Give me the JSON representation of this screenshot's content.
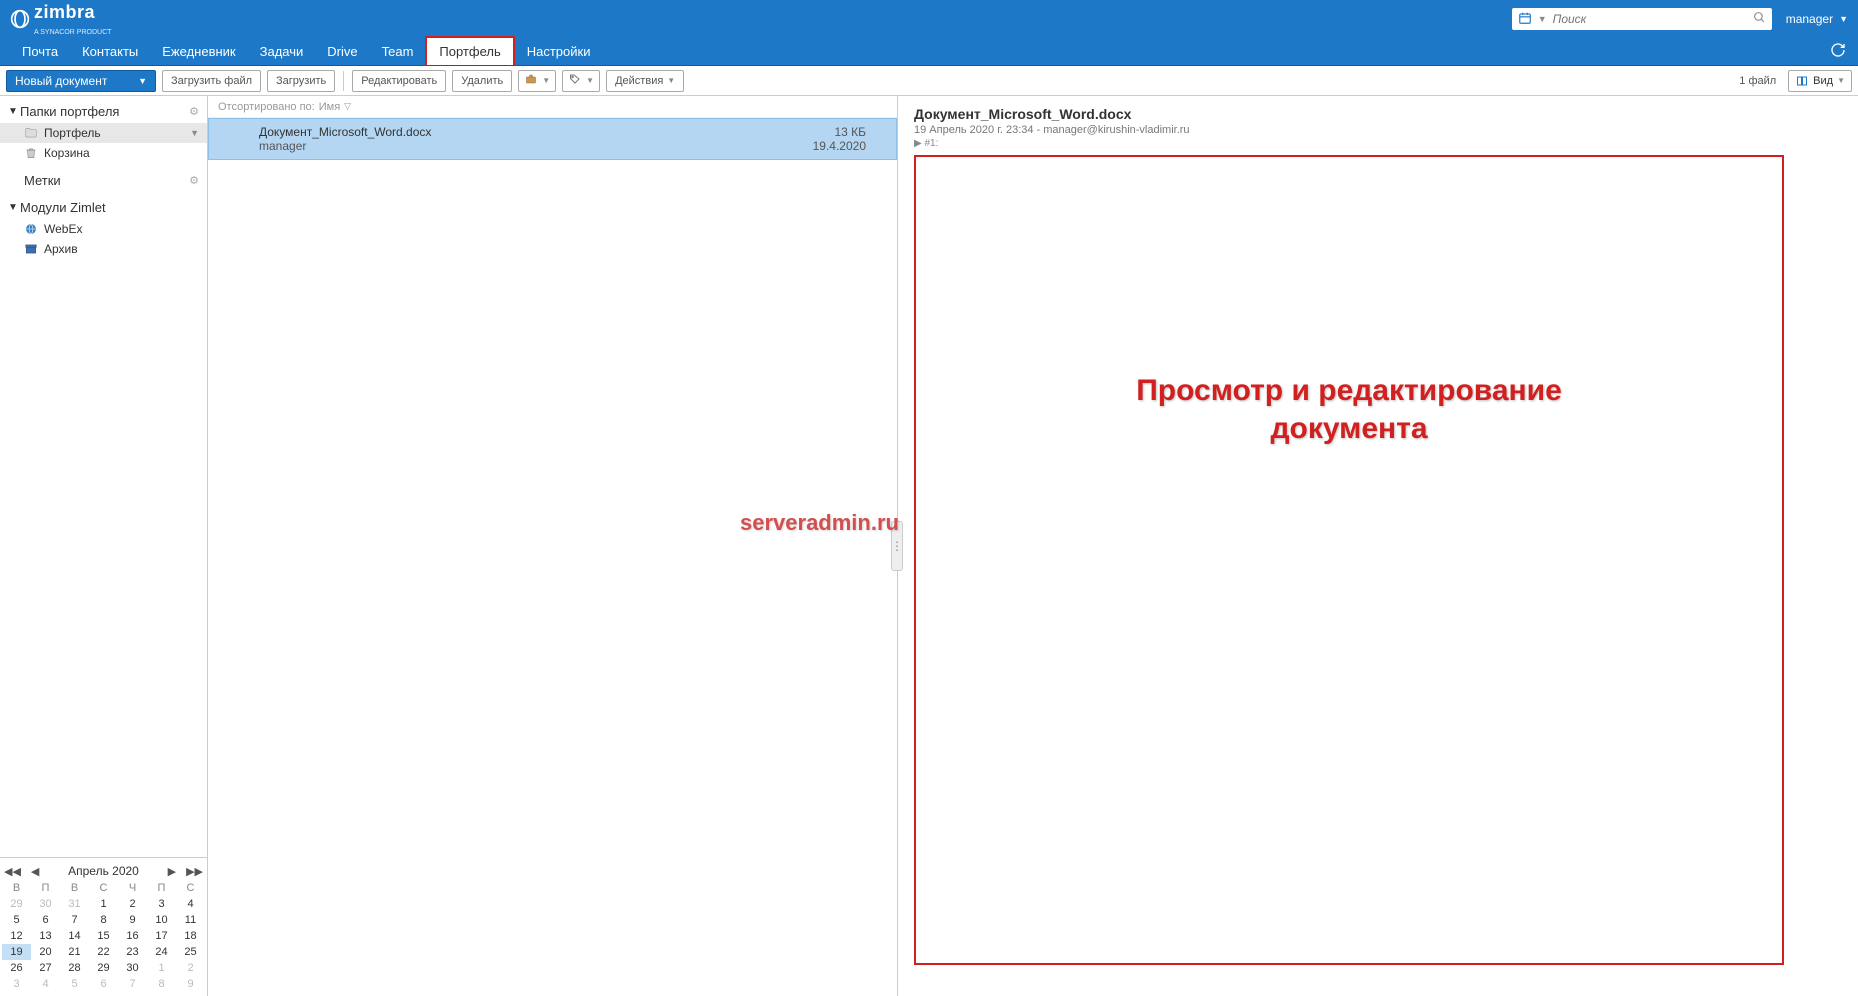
{
  "header": {
    "brand": "zimbra",
    "brand_sub": "A SYNACOR PRODUCT",
    "search_placeholder": "Поиск",
    "user": "manager"
  },
  "nav": {
    "tabs": [
      "Почта",
      "Контакты",
      "Ежедневник",
      "Задачи",
      "Drive",
      "Team",
      "Портфель",
      "Настройки"
    ],
    "active_index": 6
  },
  "toolbar": {
    "new_doc": "Новый документ",
    "upload_file": "Загрузить файл",
    "upload": "Загрузить",
    "edit": "Редактировать",
    "delete": "Удалить",
    "actions": "Действия",
    "file_count": "1 файл",
    "view": "Вид"
  },
  "sidebar": {
    "folders_title": "Папки портфеля",
    "items": [
      {
        "label": "Портфель",
        "icon": "folder",
        "selected": true,
        "caret": true
      },
      {
        "label": "Корзина",
        "icon": "trash"
      }
    ],
    "tags_title": "Метки",
    "zimlets_title": "Модули Zimlet",
    "zimlets": [
      {
        "label": "WebEx",
        "icon": "globe"
      },
      {
        "label": "Архив",
        "icon": "archive"
      }
    ]
  },
  "calendar": {
    "month": "Апрель 2020",
    "dow": [
      "В",
      "П",
      "В",
      "С",
      "Ч",
      "П",
      "С"
    ],
    "weeks": [
      [
        {
          "d": 29,
          "o": true
        },
        {
          "d": 30,
          "o": true
        },
        {
          "d": 31,
          "o": true
        },
        {
          "d": 1
        },
        {
          "d": 2
        },
        {
          "d": 3
        },
        {
          "d": 4
        }
      ],
      [
        {
          "d": 5
        },
        {
          "d": 6
        },
        {
          "d": 7
        },
        {
          "d": 8
        },
        {
          "d": 9
        },
        {
          "d": 10
        },
        {
          "d": 11
        }
      ],
      [
        {
          "d": 12
        },
        {
          "d": 13
        },
        {
          "d": 14
        },
        {
          "d": 15
        },
        {
          "d": 16
        },
        {
          "d": 17
        },
        {
          "d": 18
        }
      ],
      [
        {
          "d": 19,
          "t": true
        },
        {
          "d": 20
        },
        {
          "d": 21
        },
        {
          "d": 22
        },
        {
          "d": 23
        },
        {
          "d": 24
        },
        {
          "d": 25
        }
      ],
      [
        {
          "d": 26
        },
        {
          "d": 27
        },
        {
          "d": 28
        },
        {
          "d": 29
        },
        {
          "d": 30
        },
        {
          "d": 1,
          "o": true
        },
        {
          "d": 2,
          "o": true
        }
      ],
      [
        {
          "d": 3,
          "o": true
        },
        {
          "d": 4,
          "o": true
        },
        {
          "d": 5,
          "o": true
        },
        {
          "d": 6,
          "o": true
        },
        {
          "d": 7,
          "o": true
        },
        {
          "d": 8,
          "o": true
        },
        {
          "d": 9,
          "o": true
        }
      ]
    ]
  },
  "filelist": {
    "sort_prefix": "Отсортировано по:",
    "sort_field": "Имя",
    "items": [
      {
        "name": "Документ_Microsoft_Word.docx",
        "size": "13 КБ",
        "author": "manager",
        "date": "19.4.2020",
        "selected": true
      }
    ]
  },
  "preview": {
    "title": "Документ_Microsoft_Word.docx",
    "meta": "19 Апрель 2020 г. 23:34 - manager@kirushin-vladimir.ru",
    "marker": "▶ #1:",
    "overlay_line1": "Просмотр и редактирование",
    "overlay_line2": "документа"
  },
  "watermark": "serveradmin.ru"
}
